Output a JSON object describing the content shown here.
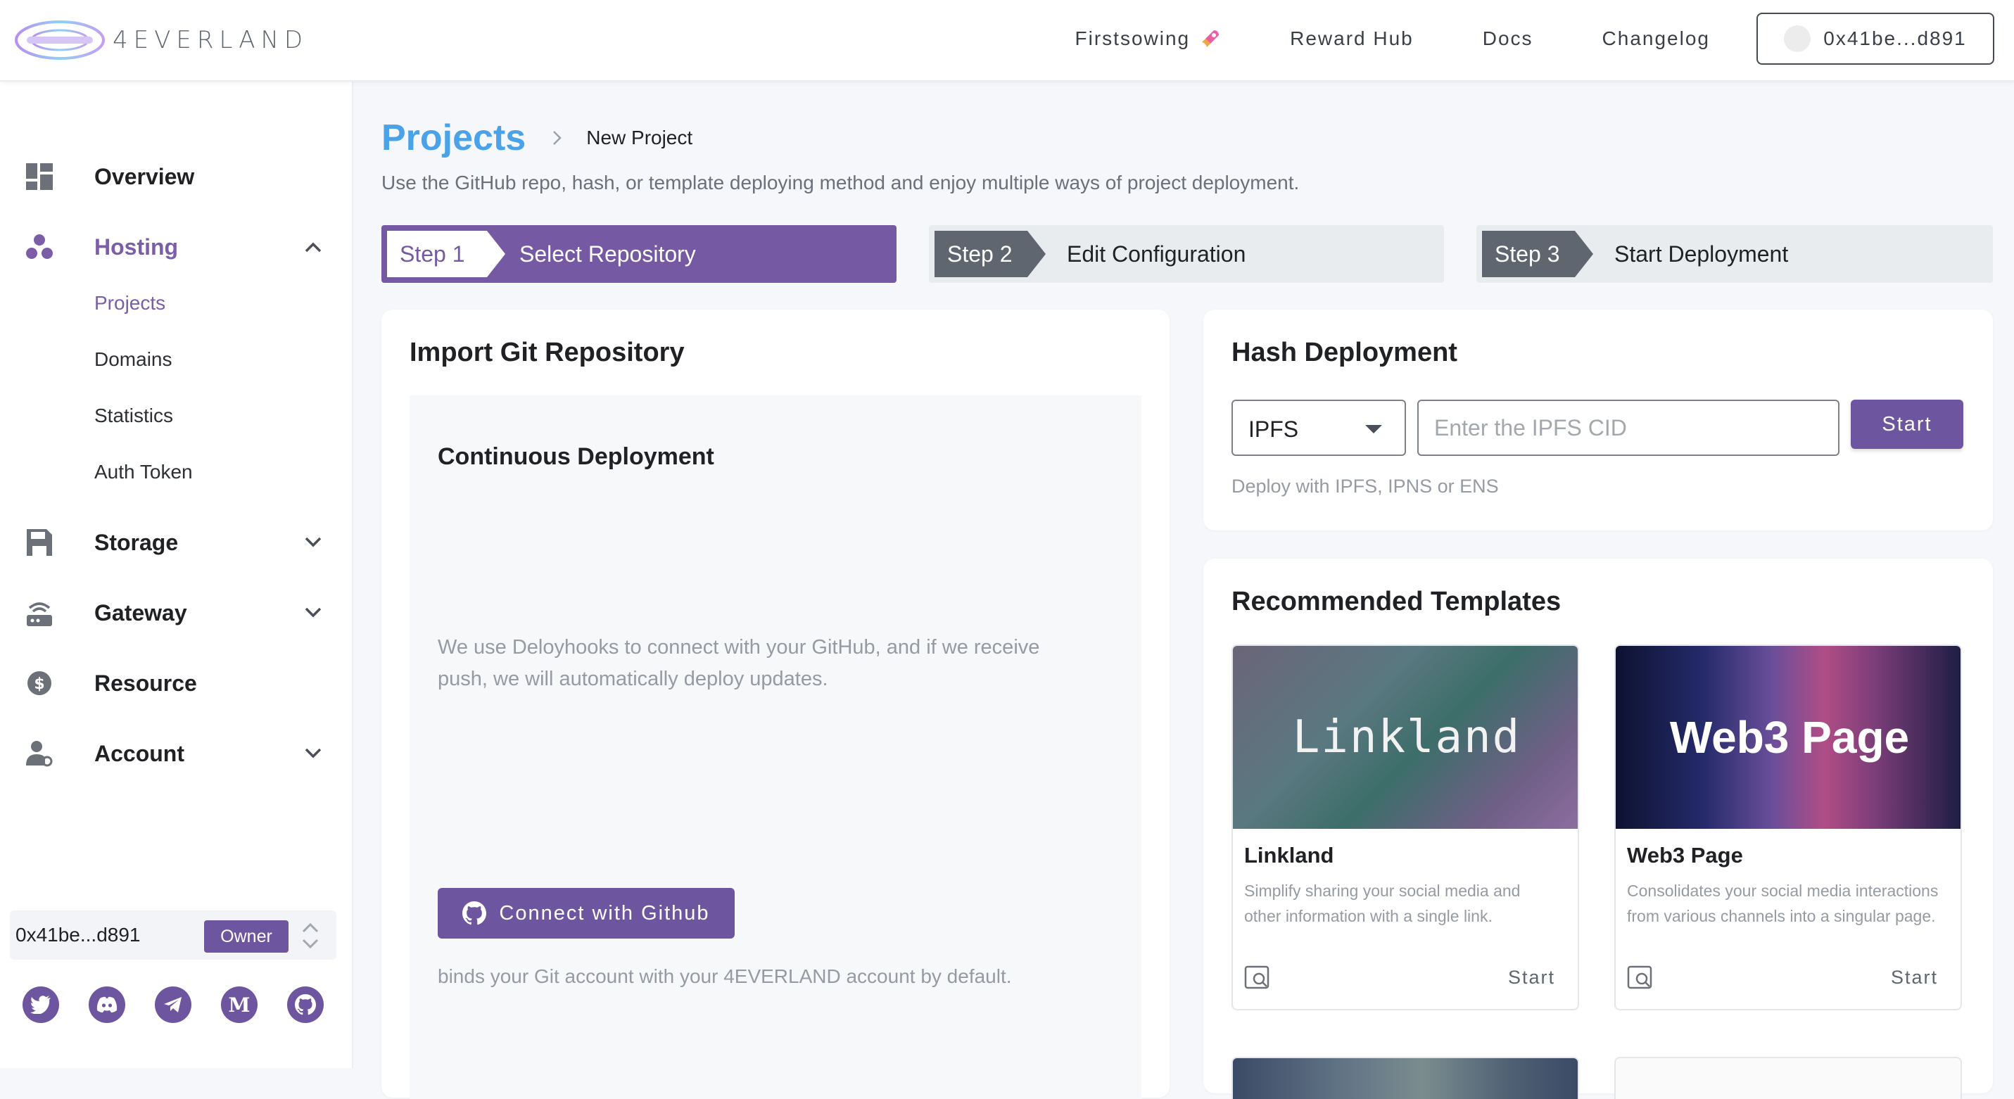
{
  "header": {
    "logo_text": "4EVERLAND",
    "nav": [
      {
        "label": "Firstsowing"
      },
      {
        "label": "Reward Hub"
      },
      {
        "label": "Docs"
      },
      {
        "label": "Changelog"
      }
    ],
    "wallet": "0x41be...d891"
  },
  "sidebar": {
    "items": [
      {
        "label": "Overview",
        "icon": "dashboard-icon"
      },
      {
        "label": "Hosting",
        "icon": "hosting-icon",
        "expanded": true
      },
      {
        "label": "Storage",
        "icon": "storage-icon"
      },
      {
        "label": "Gateway",
        "icon": "gateway-icon"
      },
      {
        "label": "Resource",
        "icon": "dollar-coin-icon"
      },
      {
        "label": "Account",
        "icon": "account-settings-icon"
      }
    ],
    "hosting_sub": [
      {
        "label": "Projects",
        "active": true
      },
      {
        "label": "Domains"
      },
      {
        "label": "Statistics"
      },
      {
        "label": "Auth Token"
      }
    ],
    "account_box": {
      "address": "0x41be...d891",
      "role": "Owner"
    },
    "socials": [
      "twitter-icon",
      "discord-icon",
      "telegram-icon",
      "medium-icon",
      "github-icon"
    ]
  },
  "breadcrumb": {
    "root": "Projects",
    "leaf": "New Project"
  },
  "subtitle": "Use the GitHub repo, hash, or template deploying method and enjoy multiple ways of project deployment.",
  "steps": [
    {
      "tag": "Step 1",
      "title": "Select Repository",
      "active": true
    },
    {
      "tag": "Step 2",
      "title": "Edit Configuration",
      "active": false
    },
    {
      "tag": "Step 3",
      "title": "Start Deployment",
      "active": false
    }
  ],
  "import_git": {
    "title": "Import Git Repository",
    "cd_title": "Continuous Deployment",
    "cd_desc": "We use Deloyhooks to connect with your GitHub, and if we receive push, we will automatically deploy updates.",
    "button": "Connect with Github",
    "note": "binds your Git account with your 4EVERLAND account by default."
  },
  "hash_deploy": {
    "title": "Hash Deployment",
    "select_value": "IPFS",
    "placeholder": "Enter the IPFS CID",
    "button": "Start",
    "note": "Deploy with IPFS, IPNS or ENS"
  },
  "templates": {
    "title": "Recommended Templates",
    "items": [
      {
        "name": "Linkland",
        "banner": "Linkland",
        "desc": "Simplify sharing your social media and other information with a single link.",
        "action": "Start"
      },
      {
        "name": "Web3 Page",
        "banner": "Web3 Page",
        "desc": "Consolidates your social media interactions from various channels into a singular page.",
        "action": "Start"
      }
    ]
  },
  "colors": {
    "accent": "#7559a3",
    "link_blue": "#4aa3e8"
  }
}
